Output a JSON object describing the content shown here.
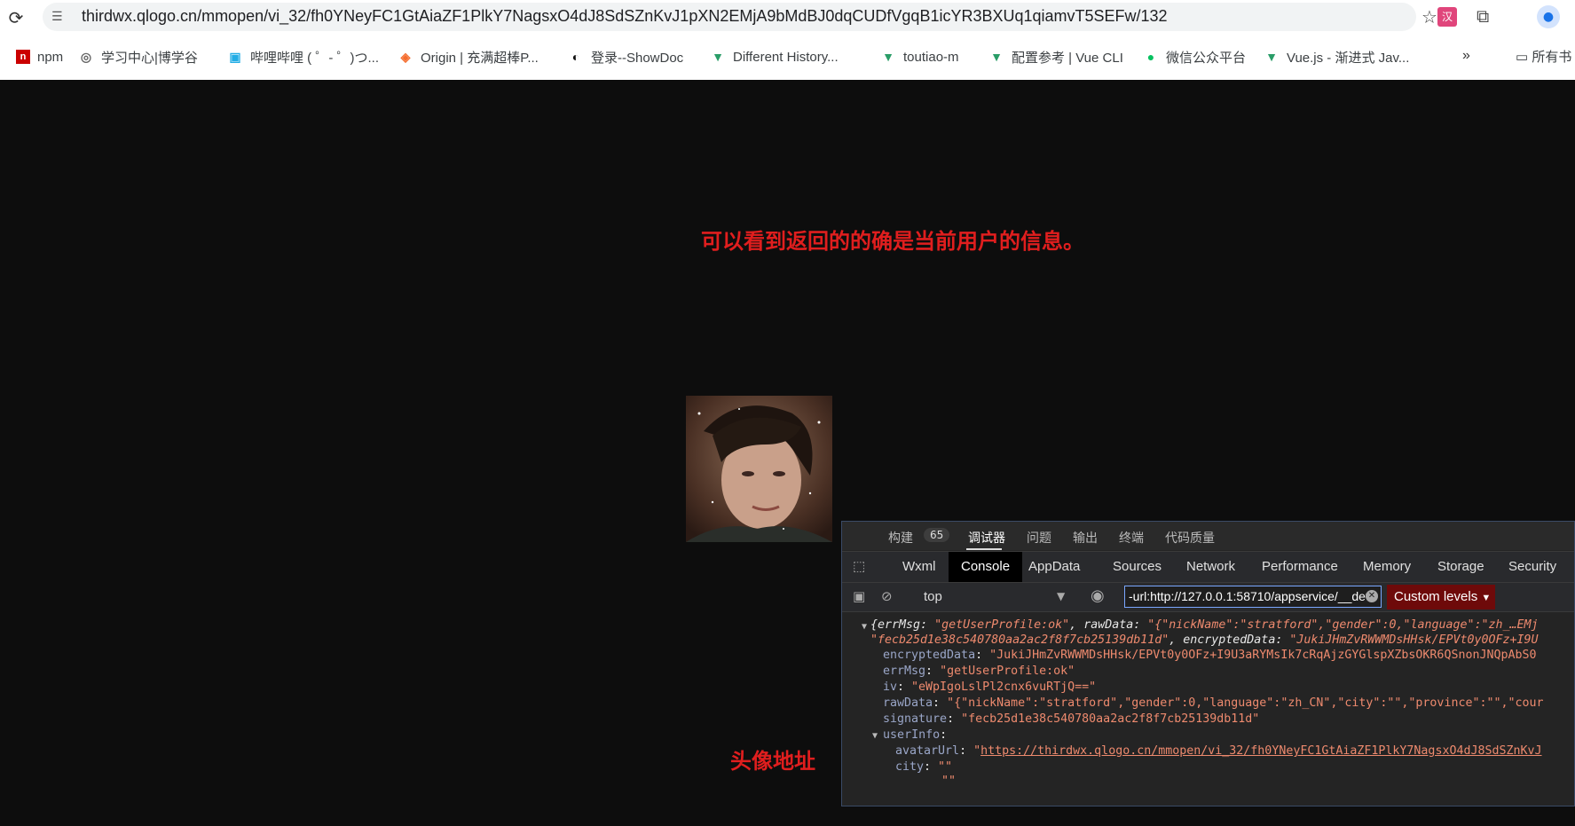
{
  "browser": {
    "url": "thirdwx.qlogo.cn/mmopen/vi_32/fh0YNeyFC1GtAiaZF1PlkY7NagsxO4dJ8SdSZnKvJ1pXN2EMjA9bMdBJ0dqCUDfVgqB1icYR3BXUq1qiamvT5SEFw/132",
    "bookmarks": [
      {
        "label": "npm",
        "icon": "npm-icon"
      },
      {
        "label": "学习中心|博学谷",
        "icon": "globe-icon"
      },
      {
        "label": "哔哩哔哩 ( ゜- ゜)つ...",
        "icon": "bilibili-icon"
      },
      {
        "label": "Origin | 充满超棒P...",
        "icon": "origin-icon"
      },
      {
        "label": "登录--ShowDoc",
        "icon": "showdoc-icon"
      },
      {
        "label": "Different History...",
        "icon": "vue-icon"
      },
      {
        "label": "toutiao-m",
        "icon": "vue-icon"
      },
      {
        "label": "配置参考 | Vue CLI",
        "icon": "vue-icon"
      },
      {
        "label": "微信公众平台",
        "icon": "wechat-icon"
      },
      {
        "label": "Vue.js - 渐进式 Jav...",
        "icon": "vue-icon"
      }
    ],
    "folder_label": "所有书",
    "ext_label": "汉"
  },
  "annotations": {
    "top": "可以看到返回的的确是当前用户的信息。",
    "avatar": "头像地址"
  },
  "devtools": {
    "top_tabs": [
      "构建",
      "调试器",
      "问题",
      "输出",
      "终端",
      "代码质量"
    ],
    "build_count": "65",
    "tabs": [
      "Wxml",
      "Console",
      "AppData",
      "Sources",
      "Network",
      "Performance",
      "Memory",
      "Storage",
      "Security"
    ],
    "context": "top",
    "filter_value": "-url:http://127.0.0.1:58710/appservice/__dev",
    "levels": "Custom levels",
    "console": {
      "line1": {
        "k1": "errMsg",
        "v1": "\"getUserProfile:ok\"",
        "k2": "rawData",
        "v2": "\"{\"nickName\":\"stratford\",\"gender\":0,\"language\":\"zh_…EMj",
        "v3": "\"fecb25d1e38c540780aa2ac2f8f7cb25139db11d\"",
        "k4": "encryptedData",
        "v4": "\"JukiJHmZvRWWMDsHHsk/EPVt0y0OFz+I9U"
      },
      "encryptedData": {
        "k": "encryptedData",
        "v": "\"JukiJHmZvRWWMDsHHsk/EPVt0y0OFz+I9U3aRYMsIk7cRqAjzGYGlspXZbsOKR6QSnonJNQpAbS0"
      },
      "errMsg": {
        "k": "errMsg",
        "v": "\"getUserProfile:ok\""
      },
      "iv": {
        "k": "iv",
        "v": "\"eWpIgoLslPl2cnx6vuRTjQ==\""
      },
      "rawData": {
        "k": "rawData",
        "v": "\"{\"nickName\":\"stratford\",\"gender\":0,\"language\":\"zh_CN\",\"city\":\"\",\"province\":\"\",\"cour"
      },
      "signature": {
        "k": "signature",
        "v": "\"fecb25d1e38c540780aa2ac2f8f7cb25139db11d\""
      },
      "userInfo": {
        "k": "userInfo"
      },
      "avatarUrl": {
        "k": "avatarUrl",
        "q": "\"",
        "v": "https://thirdwx.qlogo.cn/mmopen/vi_32/fh0YNeyFC1GtAiaZF1PlkY7NagsxO4dJ8SdSZnKvJ"
      },
      "city": {
        "k": "city",
        "v": "\"\""
      },
      "country": {
        "v": "\"\""
      }
    }
  }
}
